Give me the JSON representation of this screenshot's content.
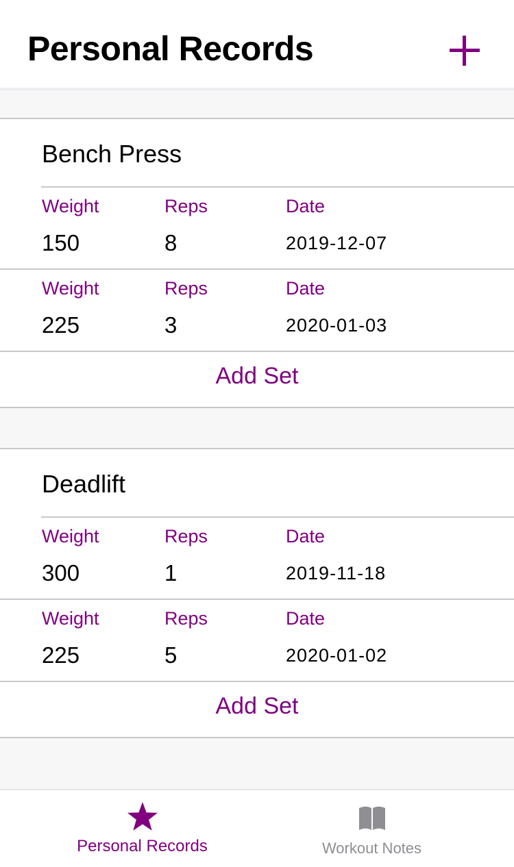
{
  "header": {
    "title": "Personal Records"
  },
  "exercises": [
    {
      "name": "Bench Press",
      "sets": [
        {
          "weight_label": "Weight",
          "reps_label": "Reps",
          "date_label": "Date",
          "weight": "150",
          "reps": "8",
          "date": "2019-12-07"
        },
        {
          "weight_label": "Weight",
          "reps_label": "Reps",
          "date_label": "Date",
          "weight": "225",
          "reps": "3",
          "date": "2020-01-03"
        }
      ],
      "add_set_label": "Add Set"
    },
    {
      "name": "Deadlift",
      "sets": [
        {
          "weight_label": "Weight",
          "reps_label": "Reps",
          "date_label": "Date",
          "weight": "300",
          "reps": "1",
          "date": "2019-11-18"
        },
        {
          "weight_label": "Weight",
          "reps_label": "Reps",
          "date_label": "Date",
          "weight": "225",
          "reps": "5",
          "date": "2020-01-02"
        }
      ],
      "add_set_label": "Add Set"
    }
  ],
  "tabbar": {
    "tabs": [
      {
        "label": "Personal Records",
        "icon": "star-icon",
        "active": true
      },
      {
        "label": "Workout Notes",
        "icon": "book-icon",
        "active": false
      }
    ]
  },
  "colors": {
    "accent": "#800080",
    "inactive": "#8e8e93"
  }
}
